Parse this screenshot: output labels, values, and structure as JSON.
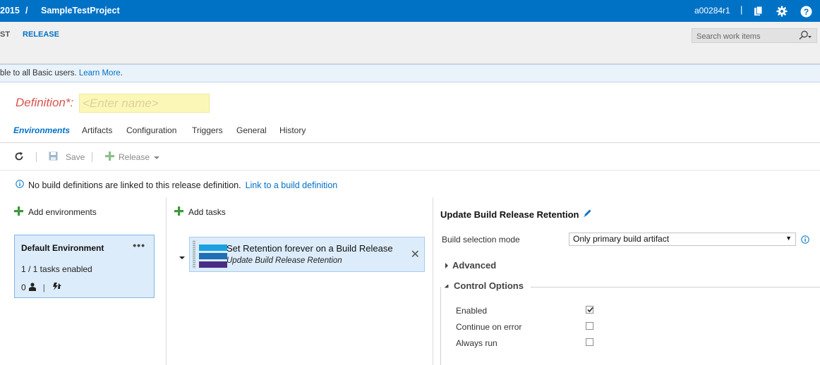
{
  "header": {
    "breadcrumb_prefix": "2015",
    "breadcrumb_sep": "/",
    "project": "SampleTestProject",
    "user": "a00284r1",
    "user_sep": "|"
  },
  "hub": {
    "partial_tab": "ST",
    "release_tab": "RELEASE",
    "search_placeholder": "Search work items"
  },
  "notice": {
    "text": "ble to all Basic users. ",
    "link": "Learn More",
    "trailing": "."
  },
  "definition": {
    "label": "Definition*:",
    "placeholder": "<Enter name>"
  },
  "tabs": [
    {
      "label": "Environments"
    },
    {
      "label": "Artifacts"
    },
    {
      "label": "Configuration"
    },
    {
      "label": "Triggers"
    },
    {
      "label": "General"
    },
    {
      "label": "History"
    }
  ],
  "toolbar": {
    "save": "Save",
    "release": "Release"
  },
  "info": {
    "text": "No build definitions are linked to this release definition.",
    "link": "Link to a build definition"
  },
  "environments": {
    "add_label": "Add environments",
    "card": {
      "name": "Default Environment",
      "menu": "•••",
      "tasks": "1 / 1 tasks enabled",
      "approvers_count": "0",
      "sep": "|"
    }
  },
  "tasks": {
    "add_label": "Add tasks",
    "items": [
      {
        "title": "Set Retention forever on a Build Release",
        "subtitle": "Update Build Release Retention",
        "close": "✕"
      }
    ]
  },
  "task_panel": {
    "title": "Update Build Release Retention",
    "build_selection_label": "Build selection mode",
    "build_selection_value": "Only primary build artifact",
    "advanced": "Advanced",
    "control_options": "Control Options",
    "options": [
      {
        "label": "Enabled",
        "checked": true
      },
      {
        "label": "Continue on error",
        "checked": false
      },
      {
        "label": "Always run",
        "checked": false
      }
    ]
  },
  "colors": {
    "topbar": "#0072c6",
    "accent": "#0072c6",
    "card_bg": "#dcecfa",
    "definition_label": "#d9534f",
    "add_icon": "#3c9a3c",
    "task_stripe_1": "#1ba1e2",
    "task_stripe_2": "#1e6fb5",
    "task_stripe_3": "#4b2c85"
  }
}
